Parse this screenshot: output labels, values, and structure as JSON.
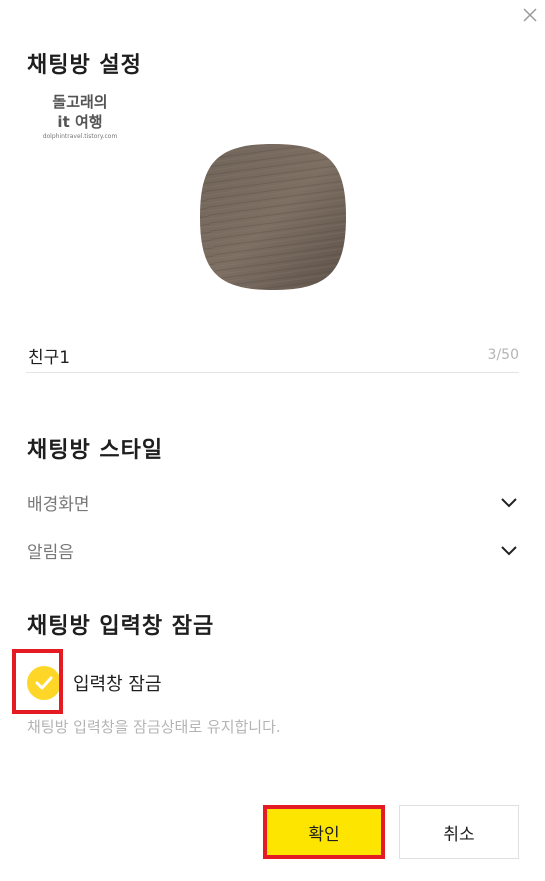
{
  "dialog": {
    "title": "채팅방 설정",
    "close_icon": "close-icon"
  },
  "watermark": {
    "line1": "돌고래의",
    "line2": "it 여행",
    "line3": "dolphintravel.tistory.com"
  },
  "profile": {
    "image": "wood-texture-profile-image"
  },
  "name_field": {
    "value": "친구1",
    "counter": "3/50"
  },
  "style_section": {
    "title": "채팅방 스타일",
    "items": [
      {
        "label": "배경화면",
        "icon": "chevron-down-icon"
      },
      {
        "label": "알림음",
        "icon": "chevron-down-icon"
      }
    ]
  },
  "lock_section": {
    "title": "채팅방 입력창 잠금",
    "checkbox_label": "입력창 잠금",
    "checked": true,
    "description": "채팅방 입력창을 잠금상태로 유지합니다."
  },
  "buttons": {
    "confirm": "확인",
    "cancel": "취소"
  },
  "colors": {
    "accent_yellow": "#fee500",
    "check_yellow": "#fdd628",
    "highlight_red": "#e41b23"
  }
}
